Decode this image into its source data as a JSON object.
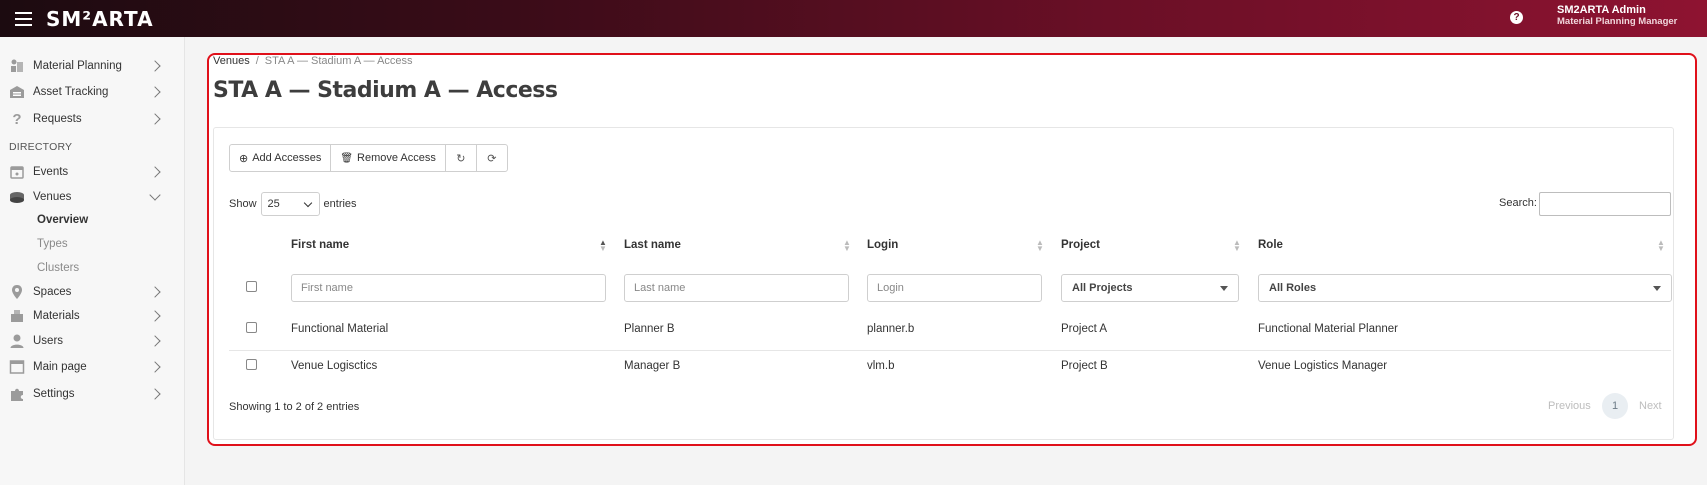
{
  "app": {
    "brand": "SM²ARTA"
  },
  "header": {
    "user_name": "SM2ARTA Admin",
    "user_role": "Material Planning Manager",
    "help": "?"
  },
  "sidebar": {
    "items": [
      {
        "label": "Material Planning",
        "icon": "material-planning-icon"
      },
      {
        "label": "Asset Tracking",
        "icon": "warehouse-icon"
      },
      {
        "label": "Requests",
        "icon": "question-icon"
      }
    ],
    "section": "DIRECTORY",
    "dir_items": [
      {
        "label": "Events",
        "icon": "calendar-icon"
      },
      {
        "label": "Venues",
        "icon": "stadium-icon"
      }
    ],
    "venue_sub": [
      {
        "label": "Overview"
      },
      {
        "label": "Types"
      },
      {
        "label": "Clusters"
      }
    ],
    "more_items": [
      {
        "label": "Spaces",
        "icon": "map-pin-icon"
      },
      {
        "label": "Materials",
        "icon": "materials-icon"
      },
      {
        "label": "Users",
        "icon": "user-icon"
      },
      {
        "label": "Main page",
        "icon": "window-icon"
      },
      {
        "label": "Settings",
        "icon": "puzzle-icon"
      }
    ]
  },
  "breadcrumb": {
    "root": "Venues",
    "sep": "/",
    "current": "STA A — Stadium A — Access"
  },
  "page": {
    "title": "STA A — Stadium A — Access"
  },
  "toolbar": {
    "add_label": "Add Accesses",
    "remove_label": "Remove Access",
    "add_icon": "⊕",
    "remove_icon": "🗑",
    "reload_icon": "↻",
    "refresh_icon": "⟳"
  },
  "table": {
    "show_label": "Show",
    "entries_value": "25",
    "entries_label": "entries",
    "search_label": "Search:",
    "columns": [
      "First name",
      "Last name",
      "Login",
      "Project",
      "Role"
    ],
    "filters": {
      "first_name_placeholder": "First name",
      "last_name_placeholder": "Last name",
      "login_placeholder": "Login",
      "project_value": "All Projects",
      "role_value": "All Roles"
    },
    "rows": [
      {
        "first_name": "Functional Material",
        "last_name": "Planner B",
        "login": "planner.b",
        "project": "Project A",
        "role": "Functional Material Planner"
      },
      {
        "first_name": "Venue Logisctics",
        "last_name": "Manager B",
        "login": "vlm.b",
        "project": "Project B",
        "role": "Venue Logistics Manager"
      }
    ],
    "info": "Showing 1 to 2 of 2 entries",
    "pagination": {
      "previous": "Previous",
      "page": "1",
      "next": "Next"
    }
  },
  "colors": {
    "accent_red": "#e0101a",
    "header_dark": "#1c0b10",
    "header_light": "#8e1331"
  }
}
